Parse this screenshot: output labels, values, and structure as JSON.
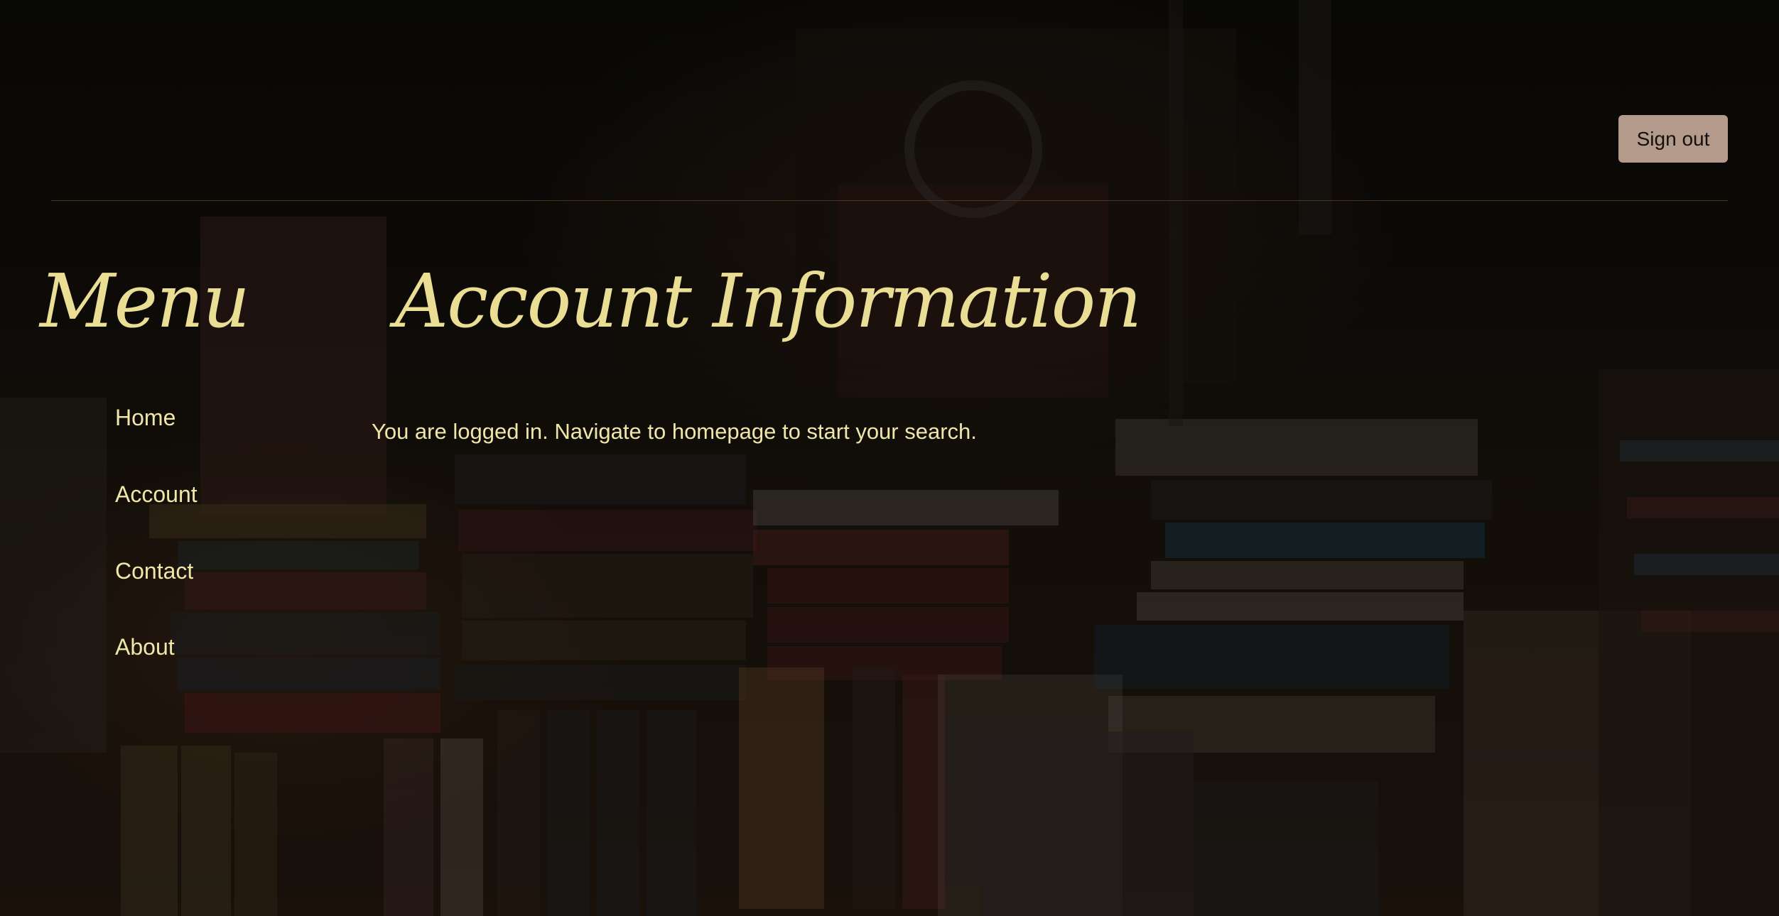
{
  "header": {
    "sign_out_label": "Sign out"
  },
  "sidebar": {
    "title": "Menu",
    "items": [
      {
        "label": "Home"
      },
      {
        "label": "Account"
      },
      {
        "label": "Contact"
      },
      {
        "label": "About"
      }
    ]
  },
  "main": {
    "title": "Account Information",
    "message": "You are logged in. Navigate to homepage to start your search."
  },
  "theme": {
    "heading_color": "#e9de94",
    "text_color": "#efe6a8",
    "button_color": "#b39a8b",
    "divider_color": "#4a3318"
  }
}
